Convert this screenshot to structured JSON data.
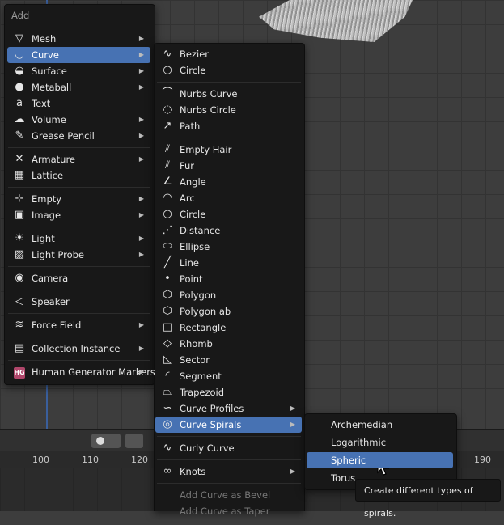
{
  "add_menu": {
    "title": "Add",
    "items": [
      {
        "label": "Mesh",
        "icon": "mesh-icon",
        "submenu": true
      },
      {
        "label": "Curve",
        "icon": "curve-icon",
        "submenu": true,
        "selected": true
      },
      {
        "label": "Surface",
        "icon": "surface-icon",
        "submenu": true
      },
      {
        "label": "Metaball",
        "icon": "metaball-icon",
        "submenu": true
      },
      {
        "label": "Text",
        "icon": "text-icon",
        "submenu": false
      },
      {
        "label": "Volume",
        "icon": "volume-icon",
        "submenu": true
      },
      {
        "label": "Grease Pencil",
        "icon": "grease-pencil-icon",
        "submenu": true
      },
      {
        "label": "Armature",
        "icon": "armature-icon",
        "submenu": true
      },
      {
        "label": "Lattice",
        "icon": "lattice-icon",
        "submenu": false
      },
      {
        "label": "Empty",
        "icon": "empty-icon",
        "submenu": true
      },
      {
        "label": "Image",
        "icon": "image-icon",
        "submenu": true
      },
      {
        "label": "Light",
        "icon": "light-icon",
        "submenu": true
      },
      {
        "label": "Light Probe",
        "icon": "light-probe-icon",
        "submenu": true
      },
      {
        "label": "Camera",
        "icon": "camera-icon",
        "submenu": false
      },
      {
        "label": "Speaker",
        "icon": "speaker-icon",
        "submenu": false
      },
      {
        "label": "Force Field",
        "icon": "force-field-icon",
        "submenu": true
      },
      {
        "label": "Collection Instance",
        "icon": "collection-icon",
        "submenu": true
      },
      {
        "label": "Human Generator Markers",
        "icon": "hg-icon",
        "icon_text": "HG",
        "submenu": true
      }
    ]
  },
  "curve_menu": {
    "items": [
      {
        "label": "Bezier",
        "icon": "bezier-icon"
      },
      {
        "label": "Circle",
        "icon": "circle-curve-icon"
      },
      {
        "label": "Nurbs Curve",
        "icon": "nurbs-curve-icon"
      },
      {
        "label": "Nurbs Circle",
        "icon": "nurbs-circle-icon"
      },
      {
        "label": "Path",
        "icon": "path-icon"
      },
      {
        "label": "Empty Hair",
        "icon": "empty-hair-icon"
      },
      {
        "label": "Fur",
        "icon": "fur-icon"
      },
      {
        "label": "Angle",
        "icon": "angle-icon"
      },
      {
        "label": "Arc",
        "icon": "arc-icon"
      },
      {
        "label": "Circle",
        "icon": "circle-icon"
      },
      {
        "label": "Distance",
        "icon": "distance-icon"
      },
      {
        "label": "Ellipse",
        "icon": "ellipse-icon"
      },
      {
        "label": "Line",
        "icon": "line-icon"
      },
      {
        "label": "Point",
        "icon": "point-icon"
      },
      {
        "label": "Polygon",
        "icon": "polygon-icon"
      },
      {
        "label": "Polygon ab",
        "icon": "polygon-ab-icon"
      },
      {
        "label": "Rectangle",
        "icon": "rectangle-icon"
      },
      {
        "label": "Rhomb",
        "icon": "rhomb-icon"
      },
      {
        "label": "Sector",
        "icon": "sector-icon"
      },
      {
        "label": "Segment",
        "icon": "segment-icon"
      },
      {
        "label": "Trapezoid",
        "icon": "trapezoid-icon"
      },
      {
        "label": "Curve Profiles",
        "icon": "curve-profiles-icon",
        "submenu": true
      },
      {
        "label": "Curve Spirals",
        "icon": "curve-spirals-icon",
        "submenu": true,
        "selected": true
      },
      {
        "label": "Curly Curve",
        "icon": "curly-curve-icon"
      },
      {
        "label": "Knots",
        "icon": "knots-icon",
        "submenu": true
      },
      {
        "label": "Add Curve as Bevel",
        "disabled": true
      },
      {
        "label": "Add Curve as Taper",
        "disabled": true
      }
    ]
  },
  "spirals_menu": {
    "items": [
      {
        "label": "Archemedian"
      },
      {
        "label": "Logarithmic"
      },
      {
        "label": "Spheric",
        "selected": true
      },
      {
        "label": "Torus"
      }
    ]
  },
  "tooltip": {
    "text": "Create different types of spirals."
  },
  "timeline": {
    "ticks": [
      "100",
      "110",
      "120",
      "190"
    ]
  },
  "colors": {
    "selection": "#4772b3",
    "menu_bg": "#181818",
    "hg_badge": "#b0476b"
  }
}
